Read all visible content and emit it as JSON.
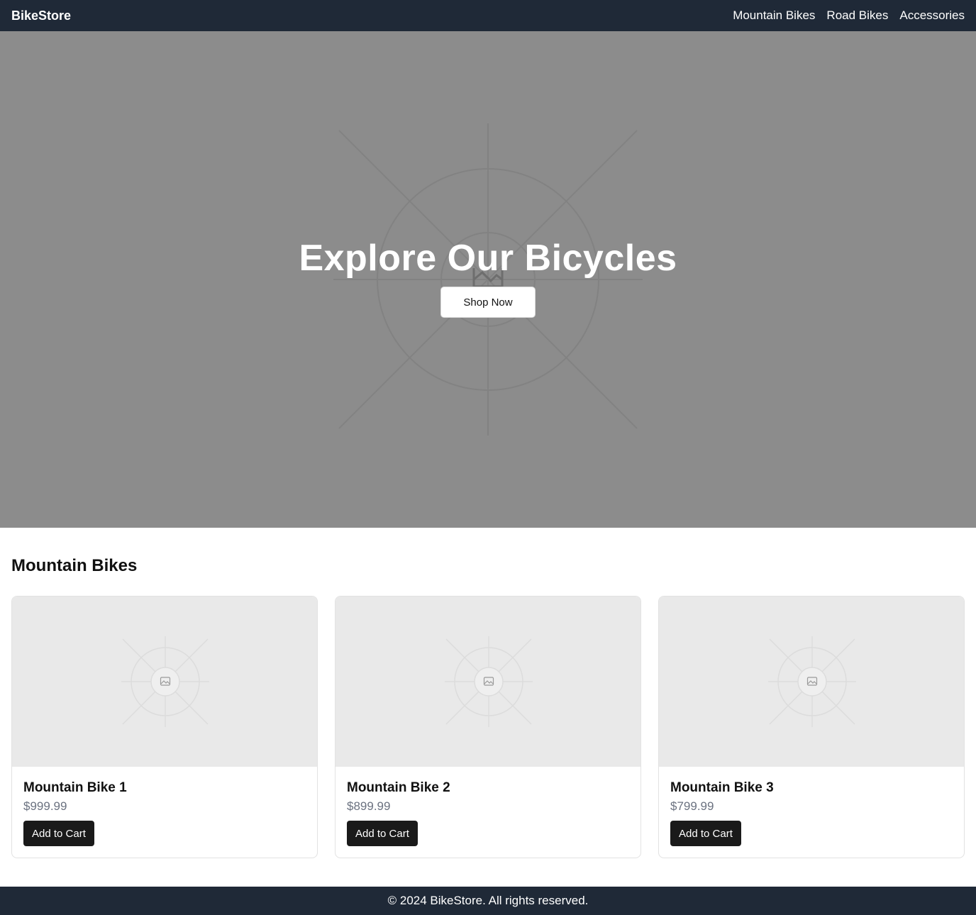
{
  "nav": {
    "brand": "BikeStore",
    "links": [
      "Mountain Bikes",
      "Road Bikes",
      "Accessories"
    ]
  },
  "hero": {
    "title": "Explore Our Bicycles",
    "button": "Shop Now",
    "image_icon": "image-placeholder-icon"
  },
  "section": {
    "title": "Mountain Bikes"
  },
  "products": [
    {
      "name": "Mountain Bike 1",
      "price": "$999.99",
      "button": "Add to Cart"
    },
    {
      "name": "Mountain Bike 2",
      "price": "$899.99",
      "button": "Add to Cart"
    },
    {
      "name": "Mountain Bike 3",
      "price": "$799.99",
      "button": "Add to Cart"
    }
  ],
  "footer": {
    "text": "© 2024 BikeStore. All rights reserved."
  },
  "colors": {
    "navbar": "#1f2937",
    "hero_background": "#8c8c8c",
    "card_image_background": "#e9e9e9",
    "button_dark": "#1a1a1a",
    "price_text": "#6b7280"
  }
}
